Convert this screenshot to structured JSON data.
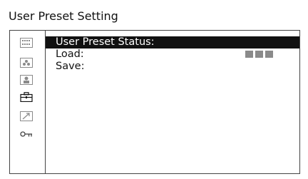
{
  "header": {
    "title": "User Preset Setting"
  },
  "sidebar": {
    "icons": [
      {
        "name": "menu-grid-icon",
        "active": false
      },
      {
        "name": "color-icon",
        "active": false
      },
      {
        "name": "user-icon",
        "active": false
      },
      {
        "name": "toolbox-icon",
        "active": true
      },
      {
        "name": "arrow-icon",
        "active": false
      },
      {
        "name": "key-icon",
        "active": false
      }
    ]
  },
  "menu": {
    "items": [
      {
        "label": "User Preset Status:",
        "selected": true
      },
      {
        "label": "Load:",
        "value_blocks": 3
      },
      {
        "label": "Save:"
      }
    ]
  },
  "colors": {
    "selected_bg": "#111111",
    "selected_text": "#ffffff",
    "value_blocks": "#8a8a8a"
  }
}
